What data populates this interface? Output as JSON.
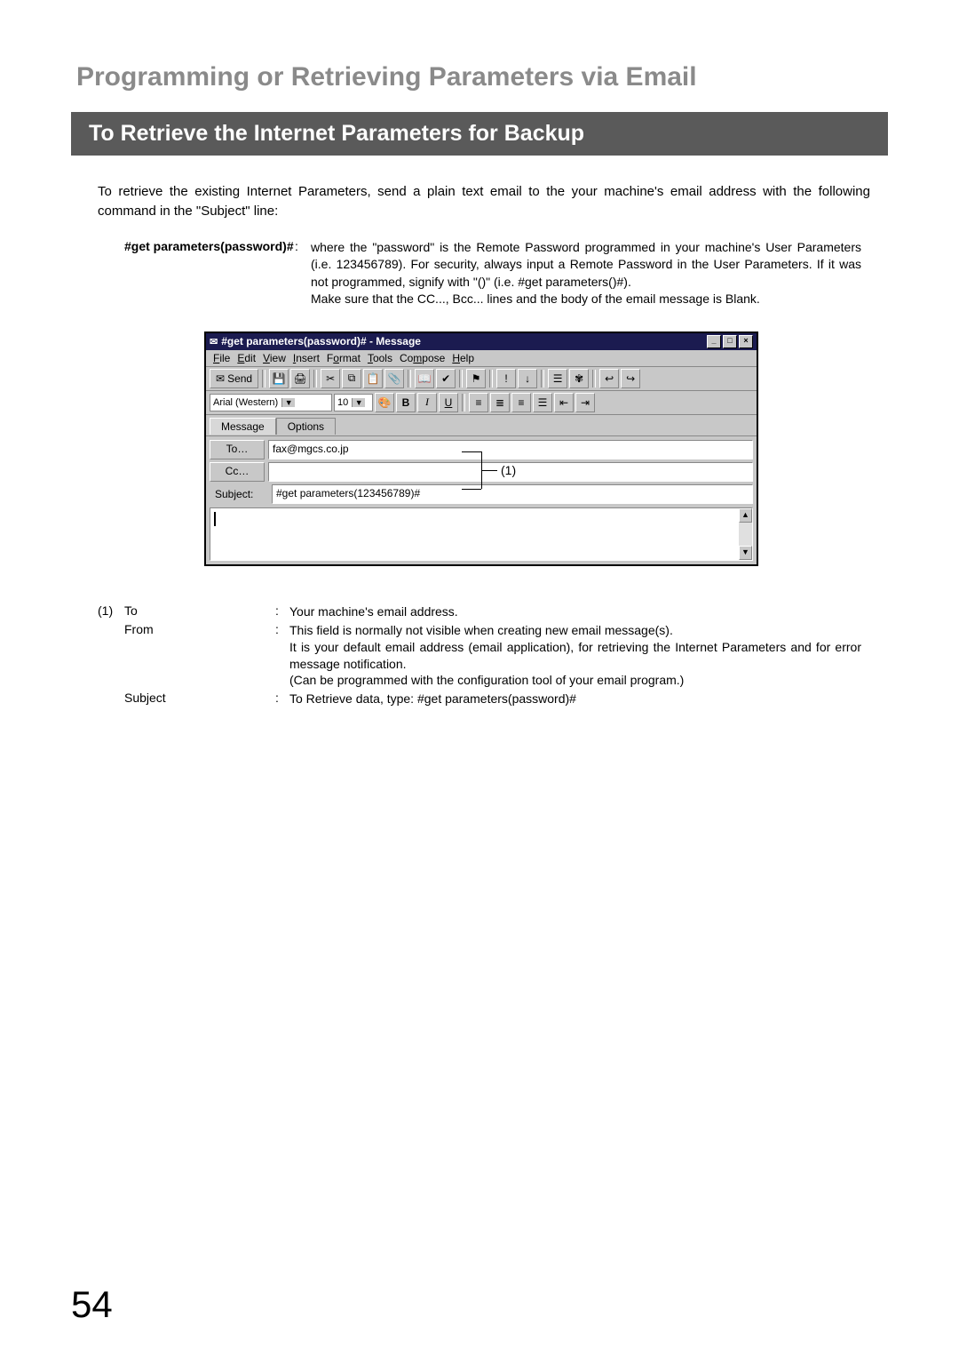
{
  "chapter_title": "Programming or Retrieving Parameters via Email",
  "section_title": "To Retrieve the Internet Parameters for Backup",
  "intro_text": "To retrieve the existing Internet Parameters, send a plain text email to the your machine's email address with the following command in the \"Subject\" line:",
  "param": {
    "term": "#get parameters(password)#",
    "colon": ":",
    "desc": "where the \"password\" is the Remote Password programmed in your machine's User Parameters (i.e. 123456789).  For security, always input a Remote Password in the User Parameters.  If it was not programmed, signify with \"()\" (i.e. #get parameters()#).\nMake sure that the CC..., Bcc... lines and the body of the email message is Blank."
  },
  "email": {
    "window_title": "#get parameters(password)# - Message",
    "menu": {
      "file": "File",
      "edit": "Edit",
      "view": "View",
      "insert": "Insert",
      "format": "Format",
      "tools": "Tools",
      "compose": "Compose",
      "help": "Help"
    },
    "send_label": "Send",
    "font_name": "Arial (Western)",
    "font_size": "10",
    "tab_message": "Message",
    "tab_options": "Options",
    "to_btn": "To…",
    "cc_btn": "Cc…",
    "subject_label": "Subject:",
    "to_value": "fax@mgcs.co.jp",
    "cc_value": "",
    "subject_value": "#get parameters(123456789)#"
  },
  "callout_num": "(1)",
  "defs": {
    "num": "(1)",
    "to_label": "To",
    "to_text": "Your machine's email address.",
    "from_label": "From",
    "from_text": "This field is normally not visible when creating new email message(s).\nIt is your default email address (email application), for retrieving the Internet Parameters and for error message notification.\n(Can be programmed with the configuration tool of your email program.)",
    "subject_label": "Subject",
    "subject_text": "To Retrieve data, type: #get parameters(password)#",
    "colon": ":"
  },
  "page_number": "54"
}
